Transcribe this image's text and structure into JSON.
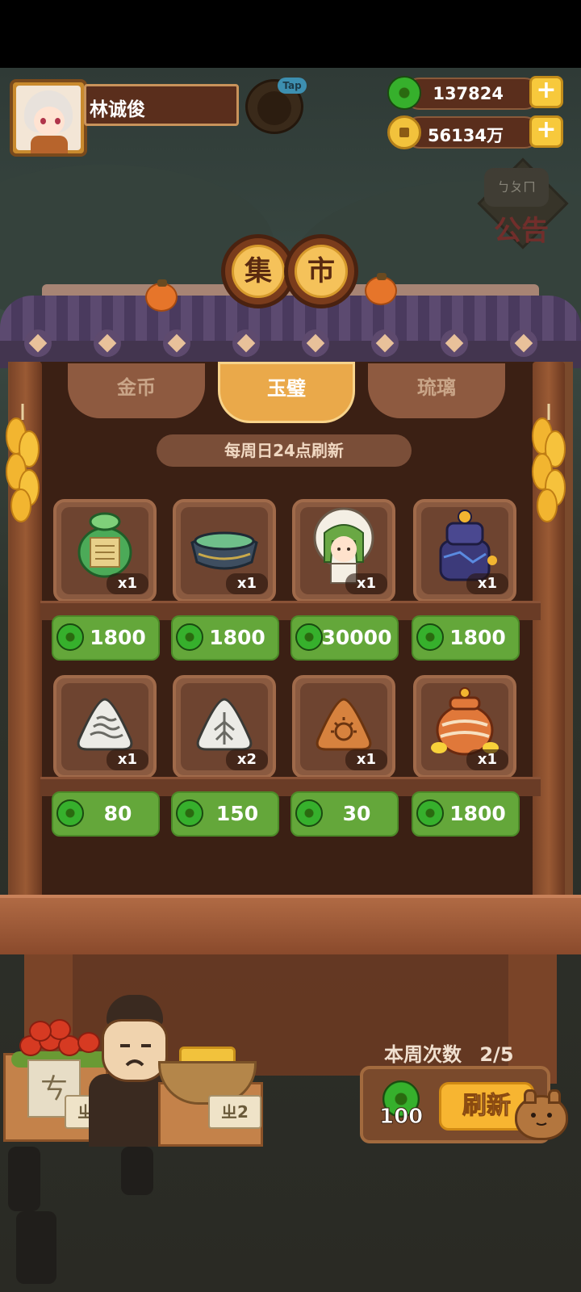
{
  "player": {
    "name": "林诚俊",
    "tap_label": "Tap"
  },
  "resources": {
    "jade": {
      "value": "137824",
      "icon": "jade-coin-icon"
    },
    "gold": {
      "value": "56134万",
      "icon": "gold-coin-icon"
    },
    "plus_label": "+"
  },
  "notice": {
    "bubble_text": "ㄅㄆㄇ",
    "label": "公告"
  },
  "market": {
    "sign_chars": [
      "集",
      "市"
    ],
    "tabs": [
      {
        "label": "金币",
        "active": false
      },
      {
        "label": "玉璧",
        "active": true
      },
      {
        "label": "琉璃",
        "active": false
      }
    ],
    "refresh_note": "每周日24点刷新",
    "items": [
      {
        "name": "jade-scroll-pouch",
        "qty": "x1",
        "price": "1800"
      },
      {
        "name": "jade-bowl",
        "qty": "x1",
        "price": "1800"
      },
      {
        "name": "green-hair-character",
        "qty": "x1",
        "price": "30000"
      },
      {
        "name": "blue-cauldron",
        "qty": "x1",
        "price": "1800"
      },
      {
        "name": "wave-triangle-stone",
        "qty": "x1",
        "price": "80"
      },
      {
        "name": "leaf-triangle-stone",
        "qty": "x2",
        "price": "150"
      },
      {
        "name": "sun-triangle-stone",
        "qty": "x1",
        "price": "30"
      },
      {
        "name": "orange-jar",
        "qty": "x1",
        "price": "1800"
      }
    ]
  },
  "refresh": {
    "week_count_label": "本周次数",
    "week_count_value": "2/5",
    "cost": "100",
    "button_label": "刷新"
  },
  "shop_decor": {
    "price_tag_left": "ㄓ2",
    "price_tag_right": "ㄓ2",
    "paper_sign": "ㄘ"
  }
}
